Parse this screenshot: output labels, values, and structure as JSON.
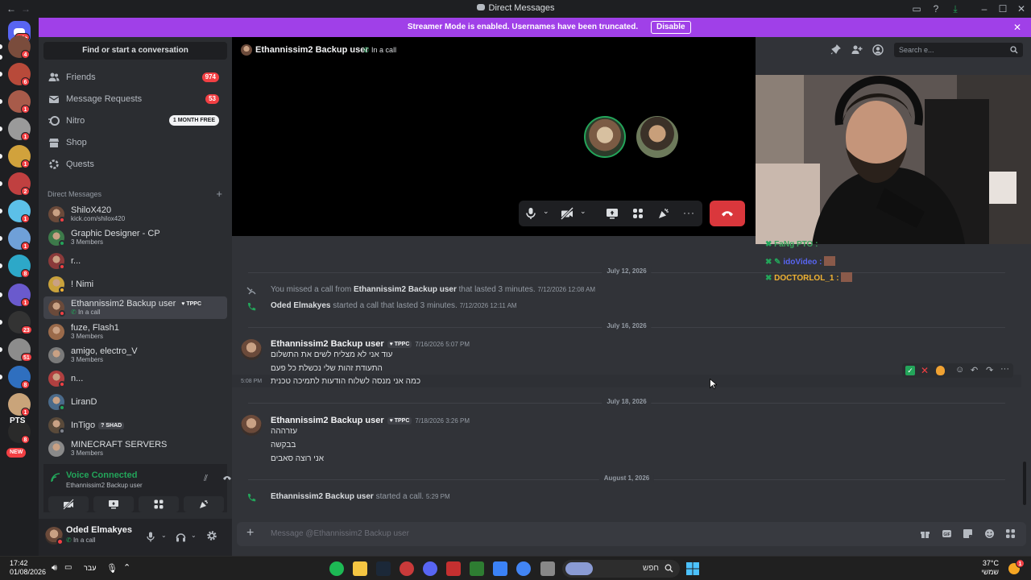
{
  "window": {
    "title": "Direct Messages"
  },
  "banner": {
    "text": "Streamer Mode is enabled. Usernames have been truncated.",
    "disable_label": "Disable"
  },
  "rail": {
    "home_badge": "1K+",
    "servers": [
      {
        "badge": "4"
      },
      {
        "badge": "6"
      },
      {
        "badge": "1"
      },
      {
        "badge": "1"
      },
      {
        "badge": "1"
      },
      {
        "badge": "2"
      },
      {
        "badge": "1"
      },
      {
        "badge": "1"
      },
      {
        "badge": "8"
      },
      {
        "badge": "1"
      },
      {
        "badge": "23"
      },
      {
        "badge": "51"
      },
      {
        "badge": "8"
      },
      {
        "badge": "1"
      },
      {
        "badge": "8"
      }
    ],
    "pts_label": "PTS",
    "new_label": "NEW"
  },
  "sidebar": {
    "find_placeholder": "Find or start a conversation",
    "nav": [
      {
        "label": "Friends",
        "count": "974"
      },
      {
        "label": "Message Requests",
        "count": "53"
      },
      {
        "label": "Nitro",
        "pill": "1 MONTH FREE"
      },
      {
        "label": "Shop"
      },
      {
        "label": "Quests"
      }
    ],
    "dm_header": "Direct Messages",
    "dms": [
      {
        "name": "ShiloX420",
        "sub": "kick.com/shilox420"
      },
      {
        "name": "Graphic Designer - CP",
        "sub": "3 Members"
      },
      {
        "name": "r..."
      },
      {
        "name": "! Nimi"
      },
      {
        "name": "Ethannissim2 Backup user",
        "tag": "TPPC",
        "sub": "In a call"
      },
      {
        "name": "fuze, Flash1",
        "sub": "3 Members"
      },
      {
        "name": "amigo, electro_V",
        "sub": "3 Members"
      },
      {
        "name": "n..."
      },
      {
        "name": "LiranD"
      },
      {
        "name": "InTigo",
        "tag": "SHAD"
      },
      {
        "name": "MINECRAFT SERVERS",
        "sub": "3 Members"
      }
    ]
  },
  "voice": {
    "status": "Voice Connected",
    "channel": "Ethannissim2 Backup user"
  },
  "user": {
    "name": "Oded Elmakyes",
    "status": "In a call"
  },
  "header": {
    "name": "Ethannissim2 Backup user",
    "call_status": "In a call",
    "search_placeholder": "Search e..."
  },
  "chat_overlay": [
    {
      "name": "FaNg PTO :",
      "color": "#3ba55d"
    },
    {
      "name": "idoVideo :",
      "color": "#5865f2"
    },
    {
      "name": "DOCTORLOL_1 :",
      "color": "#f0b232"
    }
  ],
  "messages": {
    "day1": "July 12, 2026",
    "missed_call": {
      "pre": "You missed a call from ",
      "name": "Ethannissim2 Backup user",
      "post": " that lasted 3 minutes.",
      "time": "7/12/2026 12:08 AM"
    },
    "started_call": {
      "name": "Oded Elmakyes",
      "post": " started a call that lasted 3 minutes.",
      "time": "7/12/2026 12:11 AM"
    },
    "day2": "July 16, 2026",
    "group1": {
      "author": "Ethannissim2 Backup user",
      "tag": "TPPC",
      "time": "7/16/2026 5:07 PM",
      "lines": [
        "עוד אני לא מצליח לשים את התשלום",
        "התעודת זהות שלי נכשלת כל פעם",
        "כמה אני מנסה לשלוח הודעות לתמיכה טכנית"
      ],
      "hover_time": "5:08 PM"
    },
    "day3": "July 18, 2026",
    "group2": {
      "author": "Ethannissim2 Backup user",
      "tag": "TPPC",
      "time": "7/18/2026 3:26 PM",
      "lines": [
        "עזרההה",
        "בבקשה",
        "אני רוצה סאבים"
      ]
    },
    "day4": "August 1, 2026",
    "call_start": {
      "name": "Ethannissim2 Backup user",
      "post": " started a call.",
      "time": "5:29 PM"
    }
  },
  "composer": {
    "placeholder": "Message @Ethannissim2 Backup user"
  },
  "taskbar": {
    "time": "17:42",
    "date": "01/08/2026",
    "lang": "עבר",
    "search_placeholder": "חפש",
    "weather_temp": "37°C",
    "weather_desc": "שמשי"
  },
  "colors": {
    "accent": "#5865f2",
    "banner": "#a040e8",
    "danger": "#da373c",
    "online": "#23a55a"
  }
}
